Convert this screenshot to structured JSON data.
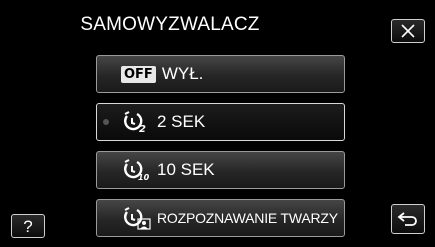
{
  "header": {
    "title": "SAMOWYZWALACZ"
  },
  "menu": {
    "items": [
      {
        "badge": "OFF",
        "label": "WYŁ.",
        "icon": "off-icon"
      },
      {
        "label": "2 SEK",
        "icon": "self-timer-2-icon",
        "sub": "2",
        "selected": true
      },
      {
        "label": "10 SEK",
        "icon": "self-timer-10-icon",
        "sub": "10"
      },
      {
        "label": "ROZPOZNAWANIE TWARZY",
        "icon": "self-timer-face-icon"
      }
    ]
  },
  "buttons": {
    "help_label": "?"
  },
  "colors": {
    "background": "#000000",
    "button_border": "#9a9a9a",
    "selected_border": "#d8d8d8"
  }
}
